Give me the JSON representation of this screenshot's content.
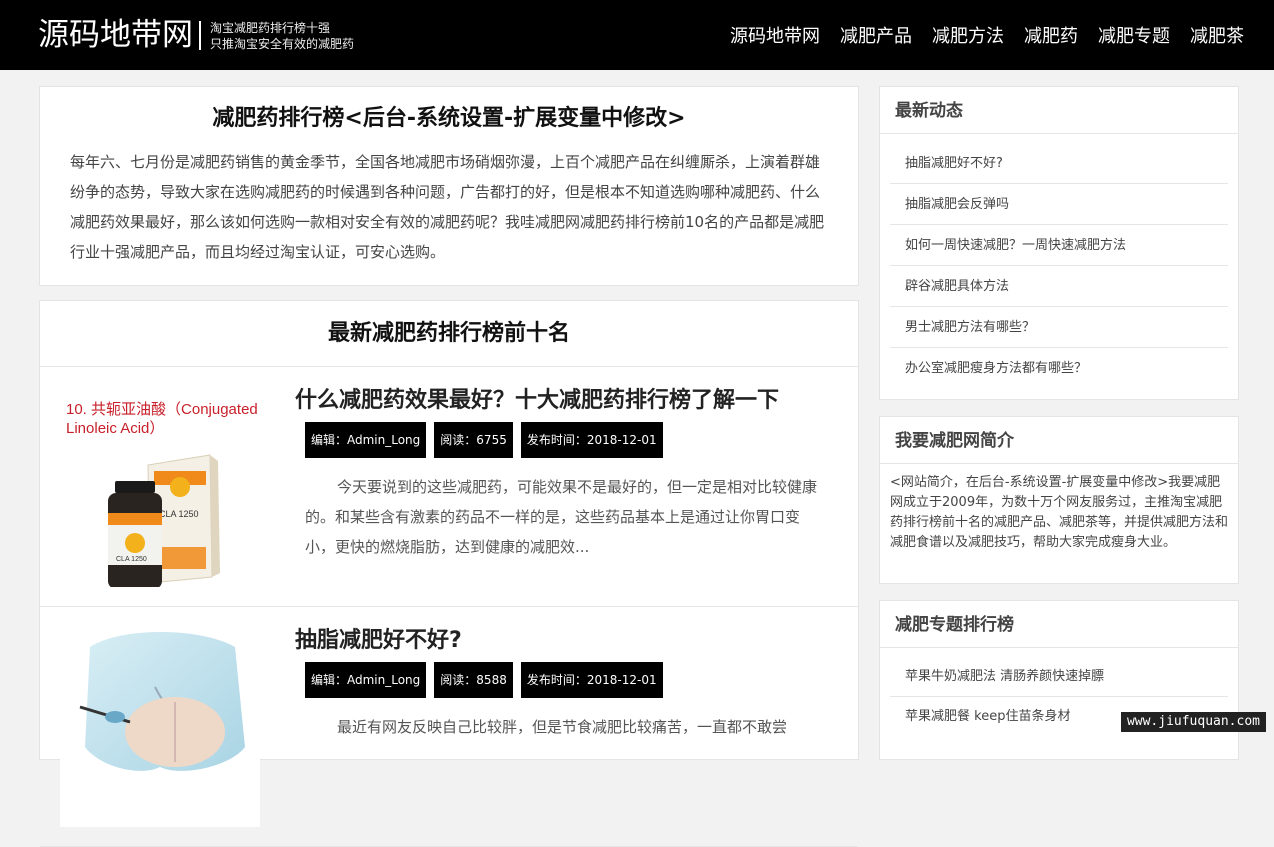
{
  "header": {
    "logo": "源码地带网",
    "tagline_line1": "淘宝减肥药排行榜十强",
    "tagline_line2": "只推淘宝安全有效的减肥药",
    "nav": [
      "源码地带网",
      "减肥产品",
      "减肥方法",
      "减肥药",
      "减肥专题",
      "减肥茶"
    ]
  },
  "intro": {
    "title": "减肥药排行榜<后台-系统设置-扩展变量中修改>",
    "text": "每年六、七月份是减肥药销售的黄金季节，全国各地减肥市场硝烟弥漫，上百个减肥产品在纠缠厮杀，上演着群雄纷争的态势，导致大家在选购减肥药的时候遇到各种问题，广告都打的好，但是根本不知道选购哪种减肥药、什么减肥药效果最好，那么该如何选购一款相对安全有效的减肥药呢？我哇减肥网减肥药排行榜前10名的产品都是减肥行业十强减肥产品，而且均经过淘宝认证，可安心选购。"
  },
  "top10": {
    "title": "最新减肥药排行榜前十名",
    "articles": [
      {
        "title": "什么减肥药效果最好？十大减肥药排行榜了解一下",
        "author": "编辑：Admin_Long",
        "views": "阅读：6755",
        "date": "发布时间：2018-12-01",
        "excerpt": "今天要说到的这些减肥药，可能效果不是最好的，但一定是相对比较健康的。和某些含有激素的药品不一样的是，这些药品基本上是通过让你胃口变小，更快的燃烧脂肪，达到健康的减肥效...",
        "thumb_caption_line1": "10. 共轭亚油酸（Conjugated",
        "thumb_caption_line2": "Linoleic Acid）",
        "thumb_box_label": "CLA 1250"
      },
      {
        "title": "抽脂减肥好不好?",
        "author": "编辑：Admin_Long",
        "views": "阅读：8588",
        "date": "发布时间：2018-12-01",
        "excerpt": "最近有网友反映自己比较胖，但是节食减肥比较痛苦，一直都不敢尝"
      }
    ]
  },
  "sidebar": {
    "news_title": "最新动态",
    "news_items": [
      "抽脂减肥好不好?",
      "抽脂减肥会反弹吗",
      "如何一周快速减肥？一周快速减肥方法",
      "辟谷减肥具体方法",
      "男士减肥方法有哪些？",
      "办公室减肥瘦身方法都有哪些？"
    ],
    "about_title": "我要减肥网简介",
    "about_text": "<网站简介，在后台-系统设置-扩展变量中修改>我要减肥网成立于2009年，为数十万个网友服务过，主推淘宝减肥药排行榜前十名的减肥产品、减肥茶等，并提供减肥方法和减肥食谱以及减肥技巧，帮助大家完成瘦身大业。",
    "topic_title": "减肥专题排行榜",
    "topic_items": [
      "苹果牛奶减肥法 清肠养颜快速掉膘",
      "苹果减肥餐 keep住苗条身材"
    ]
  },
  "watermark": "www.jiufuquan.com",
  "colors": {
    "header_bg": "#000000",
    "page_bg": "#f2f2f2",
    "meta_badge_bg": "#000000",
    "caption_red": "#c8202a"
  }
}
